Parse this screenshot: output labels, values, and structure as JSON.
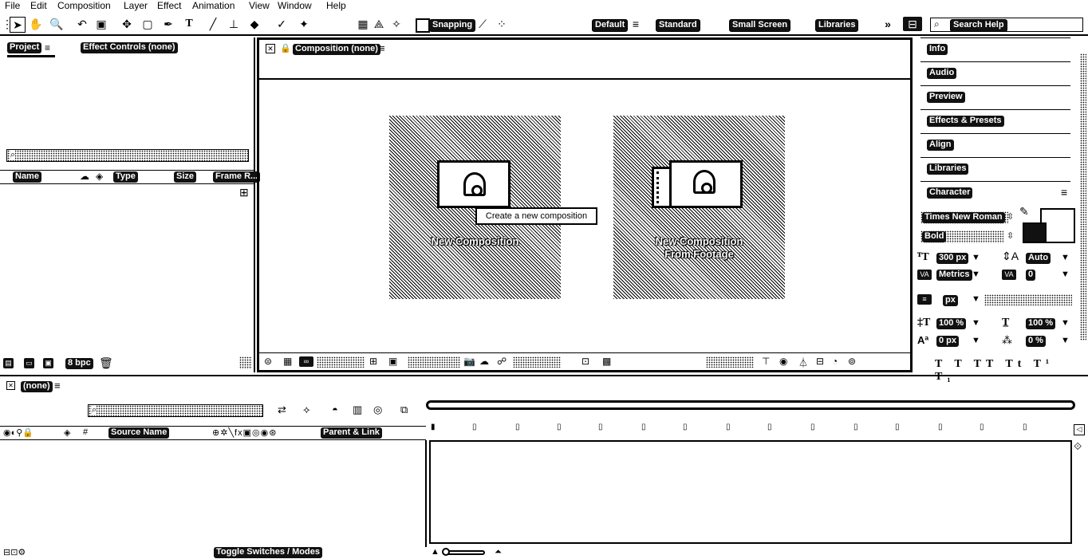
{
  "menu": [
    "File",
    "Edit",
    "Composition",
    "Layer",
    "Effect",
    "Animation",
    "View",
    "Window",
    "Help"
  ],
  "toolbar": {
    "snapping_label": "Snapping",
    "workspaces": [
      "Default",
      "Standard",
      "Small Screen",
      "Libraries"
    ],
    "more": "»",
    "search_placeholder": "Search Help"
  },
  "left_panel": {
    "tab_project": "Project",
    "tab_effect_controls": "Effect Controls (none)",
    "columns": [
      "Name",
      "Type",
      "Size",
      "Frame R..."
    ],
    "bpc": "8 bpc"
  },
  "composition_panel": {
    "tab_label": "Composition (none)",
    "card_new": "New Composition",
    "card_footage_line1": "New Composition",
    "card_footage_line2": "From Footage",
    "tooltip": "Create a new composition"
  },
  "right_panel": {
    "tabs": [
      "Info",
      "Audio",
      "Preview",
      "Effects & Presets",
      "Align",
      "Libraries",
      "Character"
    ],
    "font_family": "Times New Roman",
    "font_style": "Bold",
    "font_size": "300 px",
    "leading": "Auto",
    "kerning": "Metrics",
    "tracking": "0",
    "stroke_unit": "px",
    "vert_scale": "100 %",
    "horiz_scale": "100 %",
    "baseline": "0 px",
    "tsume": "0 %"
  },
  "timeline": {
    "tab_label": "(none)",
    "columns": [
      "Source Name",
      "Parent & Link"
    ],
    "toggle_label": "Toggle Switches / Modes"
  }
}
